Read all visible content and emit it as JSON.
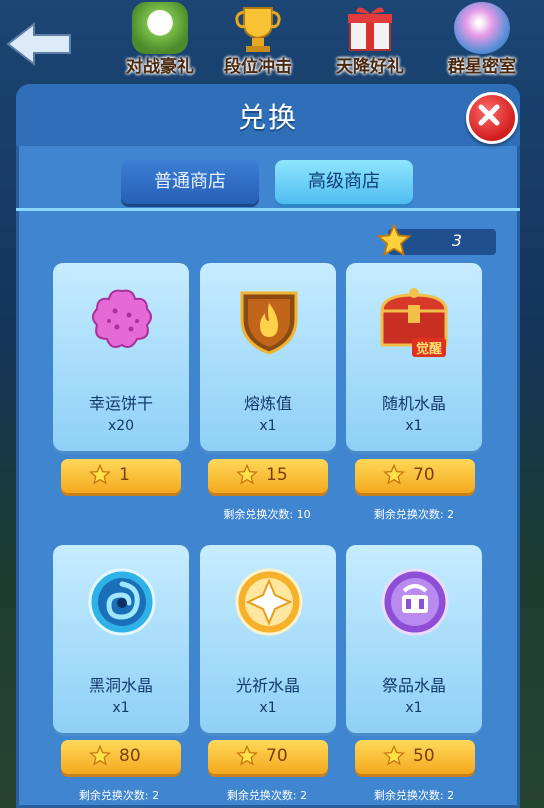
{
  "top_events": [
    "对战豪礼",
    "段位冲击",
    "天降好礼",
    "群星密室"
  ],
  "dialog": {
    "title": "兑换"
  },
  "tabs": {
    "normal": "普通商店",
    "advanced": "高级商店"
  },
  "currency": {
    "value": "3"
  },
  "items": [
    {
      "name": "幸运饼干",
      "qty": "x20",
      "price": "1",
      "remaining": ""
    },
    {
      "name": "熔炼值",
      "qty": "x1",
      "price": "15",
      "remaining": "剩余兑换次数: 10"
    },
    {
      "name": "随机水晶",
      "qty": "x1",
      "price": "70",
      "remaining": "剩余兑换次数: 2",
      "badge": "觉醒"
    },
    {
      "name": "黑洞水晶",
      "qty": "x1",
      "price": "80",
      "remaining": "剩余兑换次数: 2"
    },
    {
      "name": "光祈水晶",
      "qty": "x1",
      "price": "70",
      "remaining": "剩余兑换次数: 2"
    },
    {
      "name": "祭品水晶",
      "qty": "x1",
      "price": "50",
      "remaining": "剩余兑换次数: 2"
    }
  ],
  "icons": [
    "back-arrow-icon",
    "panda-icon",
    "trophy-icon",
    "gift-box-icon",
    "crystal-globe-icon",
    "close-icon",
    "star-icon",
    "cookie-icon",
    "flame-shield-icon",
    "treasure-chest-icon",
    "blackhole-orb-icon",
    "light-orb-icon",
    "sacrifice-orb-icon"
  ],
  "colors": {
    "price_button": "#f4a91e",
    "close_button": "#d11d1d",
    "dialog": "#3f85cf"
  }
}
